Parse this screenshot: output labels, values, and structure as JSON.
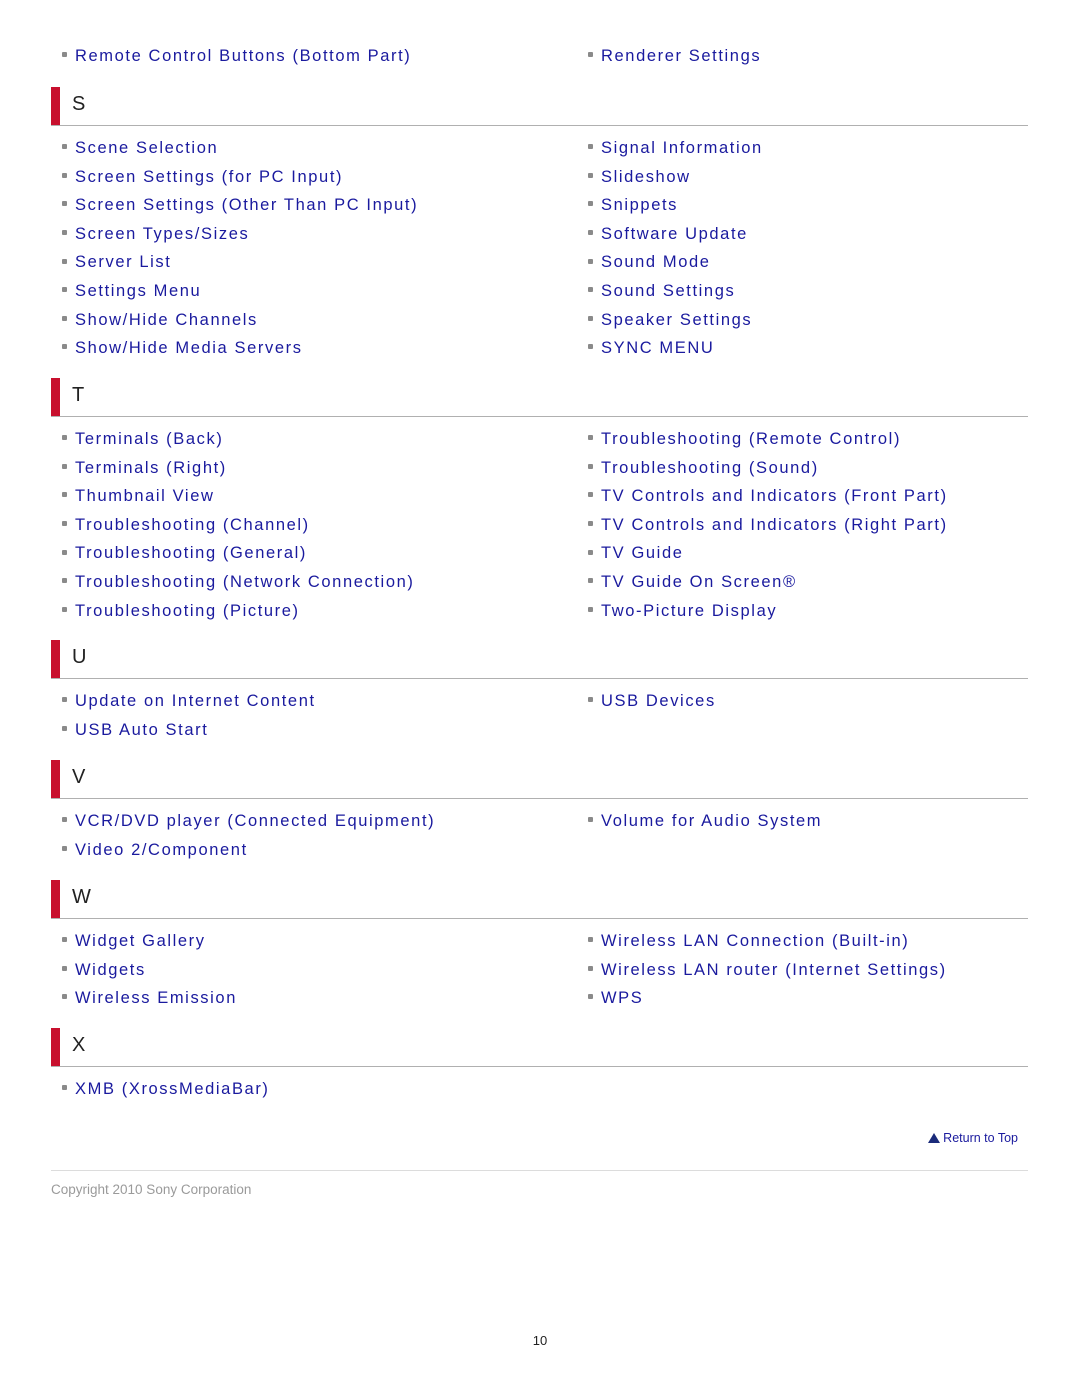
{
  "top_items": {
    "left": [
      "Remote Control Buttons (Bottom Part)"
    ],
    "right": [
      "Renderer Settings"
    ]
  },
  "sections": [
    {
      "letter": "S",
      "left": [
        "Scene Selection",
        "Screen Settings (for PC Input)",
        "Screen Settings (Other Than PC Input)",
        "Screen Types/Sizes",
        "Server List",
        "Settings Menu",
        "Show/Hide Channels",
        "Show/Hide Media Servers"
      ],
      "right": [
        "Signal Information",
        "Slideshow",
        "Snippets",
        "Software Update",
        "Sound Mode",
        "Sound Settings",
        "Speaker Settings",
        "SYNC MENU"
      ]
    },
    {
      "letter": "T",
      "left": [
        "Terminals (Back)",
        "Terminals (Right)",
        "Thumbnail View",
        "Troubleshooting (Channel)",
        "Troubleshooting (General)",
        "Troubleshooting (Network Connection)",
        "Troubleshooting (Picture)"
      ],
      "right": [
        "Troubleshooting (Remote Control)",
        "Troubleshooting (Sound)",
        "TV Controls and Indicators (Front Part)",
        "TV Controls and Indicators (Right Part)",
        "TV Guide",
        "TV Guide On Screen®",
        "Two-Picture Display"
      ]
    },
    {
      "letter": "U",
      "left": [
        "Update on Internet Content",
        "USB Auto Start"
      ],
      "right": [
        "USB Devices"
      ]
    },
    {
      "letter": "V",
      "left": [
        "VCR/DVD player (Connected Equipment)",
        "Video 2/Component"
      ],
      "right": [
        "Volume for Audio System"
      ]
    },
    {
      "letter": "W",
      "left": [
        "Widget Gallery",
        "Widgets",
        "Wireless Emission"
      ],
      "right": [
        "Wireless LAN Connection (Built-in)",
        "Wireless LAN router (Internet Settings)",
        "WPS"
      ]
    },
    {
      "letter": "X",
      "left": [
        "XMB (XrossMediaBar)"
      ],
      "right": []
    }
  ],
  "return_to_top": "Return to Top",
  "copyright": "Copyright 2010 Sony Corporation",
  "page_number": "10",
  "colors": {
    "link": "#1a1a9e",
    "accent_bar": "#c8102e",
    "bullet": "#8a8a8a"
  }
}
